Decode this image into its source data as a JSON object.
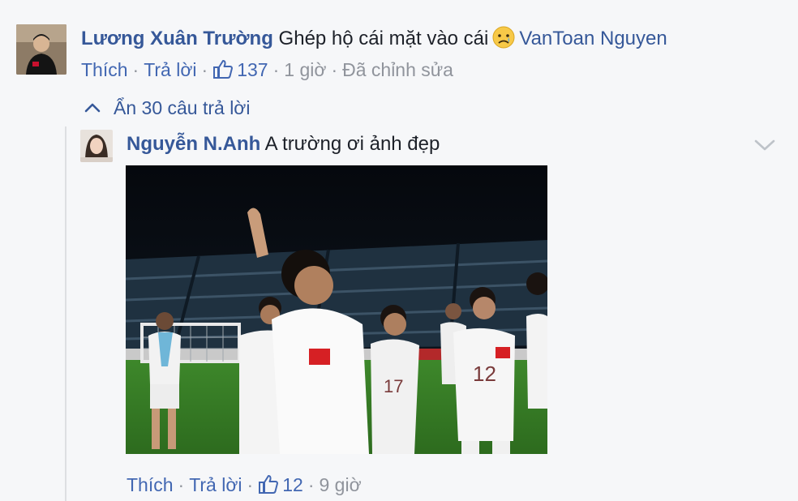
{
  "top_comment": {
    "author": "Lương Xuân Trường",
    "text": "Ghép hộ cái mặt vào cái",
    "emoji": "crying-face",
    "tagged": "VanToan Nguyen",
    "actions": {
      "like": "Thích",
      "reply": "Trả lời",
      "like_count": "137",
      "time": "1 giờ",
      "edited": "Đã chỉnh sửa"
    }
  },
  "hide_replies_label": "Ẩn 30 câu trả lời",
  "reply": {
    "author": "Nguyễn N.Anh",
    "text": "A trường ơi ảnh đẹp",
    "actions": {
      "like": "Thích",
      "reply": "Trả lời",
      "like_count": "12",
      "time": "9 giờ"
    },
    "photo": {
      "shirt_numbers": [
        "12",
        "17"
      ]
    }
  },
  "colors": {
    "link": "#365899",
    "action": "#4267b2",
    "meta": "#90949c",
    "background": "#f6f7f9"
  }
}
